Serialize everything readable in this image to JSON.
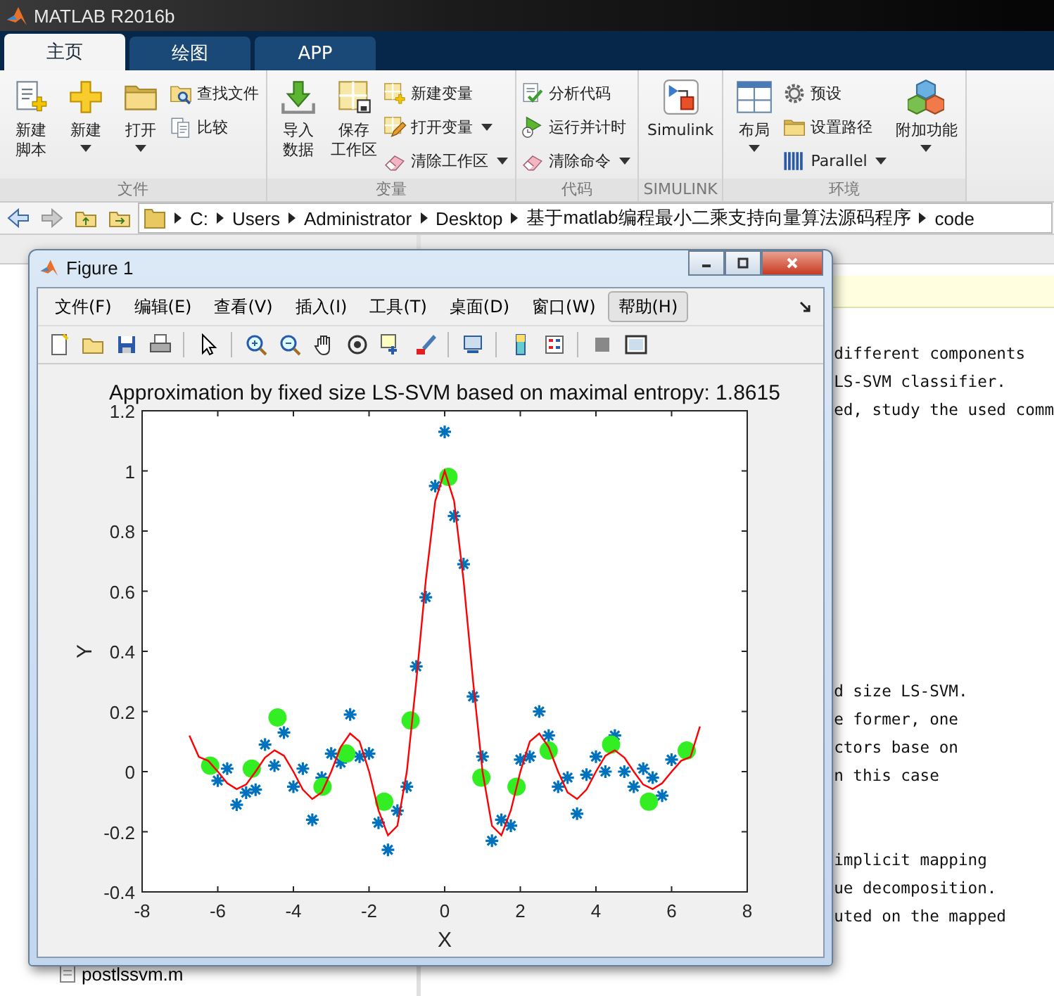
{
  "window": {
    "title": "MATLAB R2016b"
  },
  "tabs": [
    {
      "label": "主页",
      "selected": true
    },
    {
      "label": "绘图",
      "selected": false
    },
    {
      "label": "APP",
      "selected": false
    }
  ],
  "ribbon": {
    "groups": [
      {
        "label": "文件",
        "columns": [
          {
            "kind": "large",
            "lines": [
              "新建",
              "脚本"
            ],
            "dropdown": false
          },
          {
            "kind": "large",
            "lines": [
              "新建"
            ],
            "dropdown": true
          },
          {
            "kind": "large",
            "lines": [
              "打开"
            ],
            "dropdown": true
          },
          {
            "kind": "stack",
            "items": [
              {
                "label": "查找文件",
                "dropdown": false
              },
              {
                "label": "比较",
                "dropdown": false
              }
            ]
          }
        ]
      },
      {
        "label": "变量",
        "columns": [
          {
            "kind": "large",
            "lines": [
              "导入",
              "数据"
            ],
            "dropdown": false
          },
          {
            "kind": "large",
            "lines": [
              "保存",
              "工作区"
            ],
            "dropdown": false
          },
          {
            "kind": "stack",
            "items": [
              {
                "label": "新建变量",
                "dropdown": false
              },
              {
                "label": "打开变量",
                "dropdown": true
              },
              {
                "label": "清除工作区",
                "dropdown": true
              }
            ]
          }
        ]
      },
      {
        "label": "代码",
        "columns": [
          {
            "kind": "stack",
            "items": [
              {
                "label": "分析代码",
                "dropdown": false
              },
              {
                "label": "运行并计时",
                "dropdown": false
              },
              {
                "label": "清除命令",
                "dropdown": true
              }
            ]
          }
        ]
      },
      {
        "label": "SIMULINK",
        "columns": [
          {
            "kind": "large",
            "lines": [
              "Simulink"
            ],
            "dropdown": false
          }
        ]
      },
      {
        "label": "环境",
        "columns": [
          {
            "kind": "large",
            "lines": [
              "布局"
            ],
            "dropdown": true
          },
          {
            "kind": "stack",
            "items": [
              {
                "label": "预设",
                "dropdown": false
              },
              {
                "label": "设置路径",
                "dropdown": false
              },
              {
                "label": "Parallel",
                "dropdown": true
              }
            ]
          },
          {
            "kind": "large",
            "lines": [
              "附加功能"
            ],
            "dropdown": true
          }
        ]
      }
    ]
  },
  "address_bar": {
    "path": [
      "C:",
      "Users",
      "Administrator",
      "Desktop",
      "基于matlab编程最小二乘支持向量算法源码程序",
      "code"
    ]
  },
  "file_browser": {
    "files": [
      "postlssvm.m"
    ]
  },
  "command_window": {
    "blocks": [
      [
        "different components",
        "LS-SVM classifier.",
        "ed, study the used comm"
      ],
      [
        "d size LS-SVM.",
        "e former, one",
        "ctors base on",
        "n this case"
      ],
      [
        "implicit mapping",
        "ue decomposition.",
        "uted on the mapped"
      ]
    ]
  },
  "figure": {
    "title": "Figure 1",
    "menu": [
      {
        "label": "文件(F)",
        "selected": false
      },
      {
        "label": "编辑(E)",
        "selected": false
      },
      {
        "label": "查看(V)",
        "selected": false
      },
      {
        "label": "插入(I)",
        "selected": false
      },
      {
        "label": "工具(T)",
        "selected": false
      },
      {
        "label": "桌面(D)",
        "selected": false
      },
      {
        "label": "窗口(W)",
        "selected": false
      },
      {
        "label": "帮助(H)",
        "selected": true
      }
    ],
    "chart_data": {
      "type": "line",
      "title": "Approximation by fixed size LS-SVM based on maximal entropy: 1.8615",
      "xlabel": "X",
      "ylabel": "Y",
      "xlim": [
        -8,
        8
      ],
      "ylim": [
        -0.4,
        1.2
      ],
      "xticks": [
        -8,
        -6,
        -4,
        -2,
        0,
        2,
        4,
        6,
        8
      ],
      "yticks": [
        -0.4,
        -0.2,
        0,
        0.2,
        0.4,
        0.6,
        0.8,
        1,
        1.2
      ],
      "series": [
        {
          "type": "scatter",
          "color": "#0072bd",
          "x": [
            -6,
            -5.75,
            -5.5,
            -5.25,
            -5,
            -4.75,
            -4.5,
            -4.25,
            -4,
            -3.75,
            -3.5,
            -3.25,
            -3,
            -2.75,
            -2.5,
            -2.25,
            -2,
            -1.75,
            -1.5,
            -1.25,
            -1,
            -0.75,
            -0.5,
            -0.25,
            0,
            0.25,
            0.5,
            0.75,
            1,
            1.25,
            1.5,
            1.75,
            2,
            2.25,
            2.5,
            2.75,
            3,
            3.25,
            3.5,
            3.75,
            4,
            4.25,
            4.5,
            4.75,
            5,
            5.25,
            5.5,
            5.75,
            6
          ],
          "values": [
            -0.03,
            0.01,
            -0.11,
            -0.07,
            -0.06,
            0.09,
            0.02,
            0.13,
            -0.05,
            0.01,
            -0.16,
            -0.02,
            0.06,
            0.03,
            0.19,
            0.05,
            0.06,
            -0.17,
            -0.26,
            -0.13,
            -0.05,
            0.35,
            0.58,
            0.95,
            1.13,
            0.85,
            0.69,
            0.25,
            0.05,
            -0.23,
            -0.16,
            -0.18,
            0.04,
            0.05,
            0.2,
            0.12,
            -0.05,
            -0.02,
            -0.14,
            -0.01,
            0.05,
            0,
            0.12,
            0,
            -0.05,
            0.01,
            -0.02,
            -0.08,
            0.04
          ]
        },
        {
          "type": "line",
          "color": "#ff0000",
          "x": [
            -6.75,
            -6.5,
            -6.25,
            -6,
            -5.75,
            -5.5,
            -5.25,
            -5,
            -4.75,
            -4.5,
            -4.25,
            -4,
            -3.75,
            -3.5,
            -3.25,
            -3,
            -2.75,
            -2.5,
            -2.25,
            -2,
            -1.75,
            -1.5,
            -1.25,
            -1,
            -0.75,
            -0.5,
            -0.25,
            0,
            0.25,
            0.5,
            0.75,
            1,
            1.25,
            1.5,
            1.75,
            2,
            2.25,
            2.5,
            2.75,
            3,
            3.25,
            3.5,
            3.75,
            4,
            4.25,
            4.5,
            4.75,
            5,
            5.25,
            5.5,
            5.75,
            6,
            6.25,
            6.5,
            6.75
          ],
          "values": [
            0.12,
            0.049,
            0.036,
            0,
            -0.039,
            -0.058,
            -0.043,
            0,
            0.047,
            0.071,
            0.053,
            0,
            -0.06,
            -0.091,
            -0.069,
            0,
            0.082,
            0.127,
            0.1,
            0,
            -0.129,
            -0.212,
            -0.18,
            0,
            0.3,
            0.637,
            0.9,
            1,
            0.9,
            0.637,
            0.3,
            0,
            -0.18,
            -0.212,
            -0.129,
            0,
            0.1,
            0.127,
            0.082,
            0,
            -0.069,
            -0.091,
            -0.06,
            0,
            0.053,
            0.071,
            0.047,
            0,
            -0.043,
            -0.058,
            -0.039,
            0,
            0.036,
            0.049,
            0.15
          ]
        },
        {
          "type": "scatter",
          "color": "#33ee22",
          "x": [
            -6.2,
            -5.1,
            -4.42,
            -3.23,
            -2.6,
            -1.6,
            -0.9,
            0.1,
            0.97,
            1.9,
            2.75,
            4.4,
            5.4,
            6.4
          ],
          "values": [
            0.02,
            0.01,
            0.18,
            -0.05,
            0.06,
            -0.1,
            0.17,
            0.98,
            -0.02,
            -0.05,
            0.07,
            0.09,
            -0.1,
            0.07
          ]
        }
      ]
    }
  }
}
